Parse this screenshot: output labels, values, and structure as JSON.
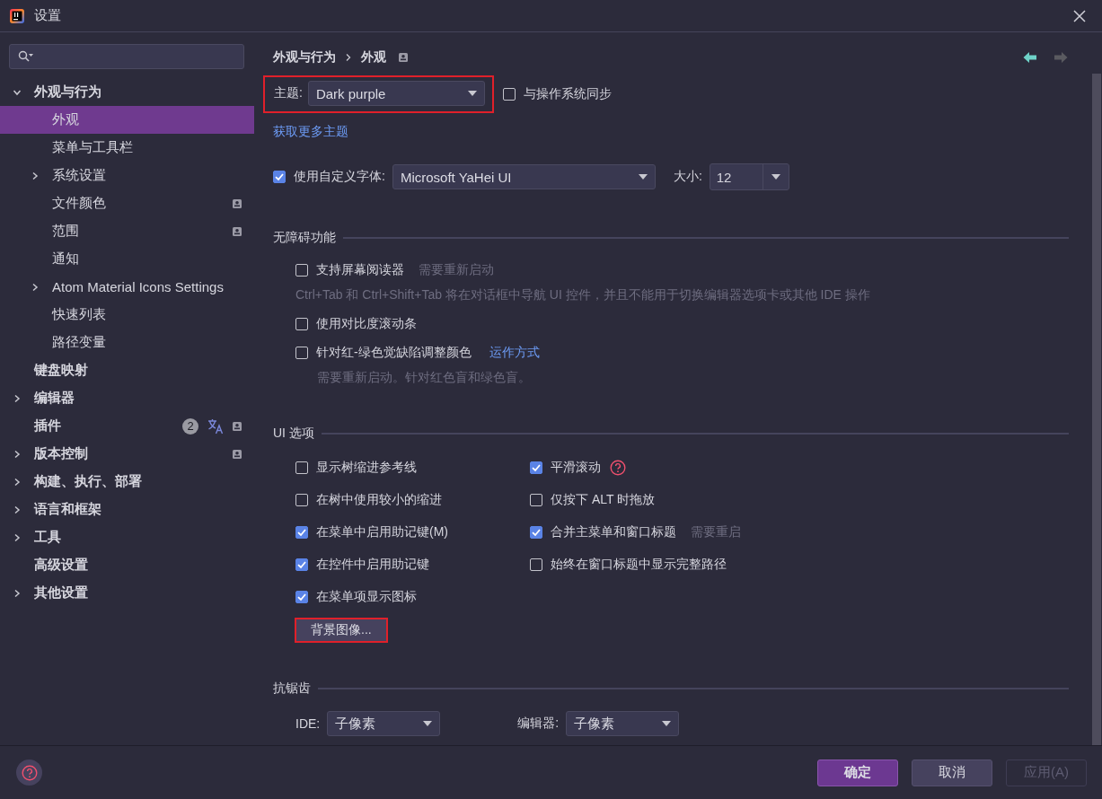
{
  "window": {
    "title": "设置"
  },
  "sidebar": {
    "items": [
      {
        "label": "外观与行为",
        "kind": "folder",
        "expanded": true,
        "selected": false,
        "scoped": false,
        "translate": false,
        "children": [
          {
            "label": "外观",
            "kind": "leaf",
            "selected": true,
            "scoped": false,
            "translate": false
          },
          {
            "label": "菜单与工具栏",
            "kind": "leaf",
            "selected": false,
            "scoped": false,
            "translate": false
          },
          {
            "label": "系统设置",
            "kind": "folder",
            "expanded": false,
            "selected": false,
            "scoped": false,
            "translate": false
          },
          {
            "label": "文件颜色",
            "kind": "leaf",
            "selected": false,
            "scoped": true,
            "translate": false
          },
          {
            "label": "范围",
            "kind": "leaf",
            "selected": false,
            "scoped": true,
            "translate": false
          },
          {
            "label": "通知",
            "kind": "leaf",
            "selected": false,
            "scoped": false,
            "translate": false
          },
          {
            "label": "Atom Material Icons Settings",
            "kind": "folder",
            "expanded": false,
            "selected": false,
            "scoped": false,
            "translate": false
          },
          {
            "label": "快速列表",
            "kind": "leaf",
            "selected": false,
            "scoped": false,
            "translate": false
          },
          {
            "label": "路径变量",
            "kind": "leaf",
            "selected": false,
            "scoped": false,
            "translate": false
          }
        ]
      },
      {
        "label": "键盘映射",
        "kind": "leaf",
        "selected": false,
        "scoped": false,
        "translate": false
      },
      {
        "label": "编辑器",
        "kind": "folder",
        "expanded": false,
        "selected": false,
        "scoped": false,
        "translate": false
      },
      {
        "label": "插件",
        "kind": "leaf",
        "selected": false,
        "badge": "2",
        "scoped": true,
        "translate": true
      },
      {
        "label": "版本控制",
        "kind": "folder",
        "expanded": false,
        "selected": false,
        "scoped": true,
        "translate": false
      },
      {
        "label": "构建、执行、部署",
        "kind": "folder",
        "expanded": false,
        "selected": false,
        "scoped": false,
        "translate": false
      },
      {
        "label": "语言和框架",
        "kind": "folder",
        "expanded": false,
        "selected": false,
        "scoped": false,
        "translate": false
      },
      {
        "label": "工具",
        "kind": "folder",
        "expanded": false,
        "selected": false,
        "scoped": false,
        "translate": false
      },
      {
        "label": "高级设置",
        "kind": "leaf",
        "selected": false,
        "scoped": false,
        "translate": false
      },
      {
        "label": "其他设置",
        "kind": "folder",
        "expanded": false,
        "selected": false,
        "scoped": false,
        "translate": false
      }
    ]
  },
  "breadcrumb": {
    "items": [
      "外观与行为",
      "外观"
    ],
    "scoped": true
  },
  "navigation": {
    "back": {
      "disabled": false
    },
    "forward": {
      "disabled": true
    }
  },
  "theme": {
    "label": "主题:",
    "value": "Dark purple",
    "highlighted": true
  },
  "sync_with_os": {
    "label": "与操作系统同步",
    "checked": false
  },
  "more_themes_link": "获取更多主题",
  "custom_font": {
    "label": "使用自定义字体:",
    "checked": true,
    "value": "Microsoft YaHei UI",
    "size_label": "大小:",
    "size": "12"
  },
  "accessibility": {
    "title": "无障碍功能",
    "options": [
      {
        "label": "支持屏幕阅读器",
        "checked": false,
        "note": "需要重新启动",
        "hint": "Ctrl+Tab 和 Ctrl+Shift+Tab 将在对话框中导航 UI 控件，并且不能用于切换编辑器选项卡或其他 IDE 操作"
      },
      {
        "label": "使用对比度滚动条",
        "checked": false
      },
      {
        "label": "针对红-绿色觉缺陷调整颜色",
        "checked": false,
        "link": "运作方式",
        "hint": "需要重新启动。针对红色盲和绿色盲。"
      }
    ]
  },
  "ui_options": {
    "title": "UI 选项",
    "left": [
      {
        "label": "显示树缩进参考线",
        "checked": false,
        "help": false
      },
      {
        "label": "在树中使用较小的缩进",
        "checked": false,
        "help": false
      },
      {
        "label": "在菜单中启用助记键(M)",
        "checked": true,
        "help": false
      },
      {
        "label": "在控件中启用助记键",
        "checked": true,
        "help": false
      },
      {
        "label": "在菜单项显示图标",
        "checked": true,
        "help": false
      }
    ],
    "right": [
      {
        "label": "平滑滚动",
        "checked": true,
        "help": true
      },
      {
        "label": "仅按下 ALT 时拖放",
        "checked": false,
        "help": false
      },
      {
        "label": "合并主菜单和窗口标题",
        "checked": true,
        "help": false,
        "note": "需要重启"
      },
      {
        "label": "始终在窗口标题中显示完整路径",
        "checked": false,
        "help": false
      }
    ],
    "background_button": {
      "label": "背景图像...",
      "highlighted": true
    }
  },
  "antialiasing": {
    "title": "抗锯齿",
    "fields": [
      {
        "label": "IDE:",
        "value": "子像素"
      },
      {
        "label": "编辑器:",
        "value": "子像素"
      }
    ]
  },
  "footer": {
    "buttons": [
      {
        "label": "确定",
        "kind": "primary",
        "disabled": false
      },
      {
        "label": "取消",
        "kind": "secondary",
        "disabled": false
      },
      {
        "label": "应用(A)",
        "kind": "secondary",
        "disabled": true
      }
    ]
  }
}
